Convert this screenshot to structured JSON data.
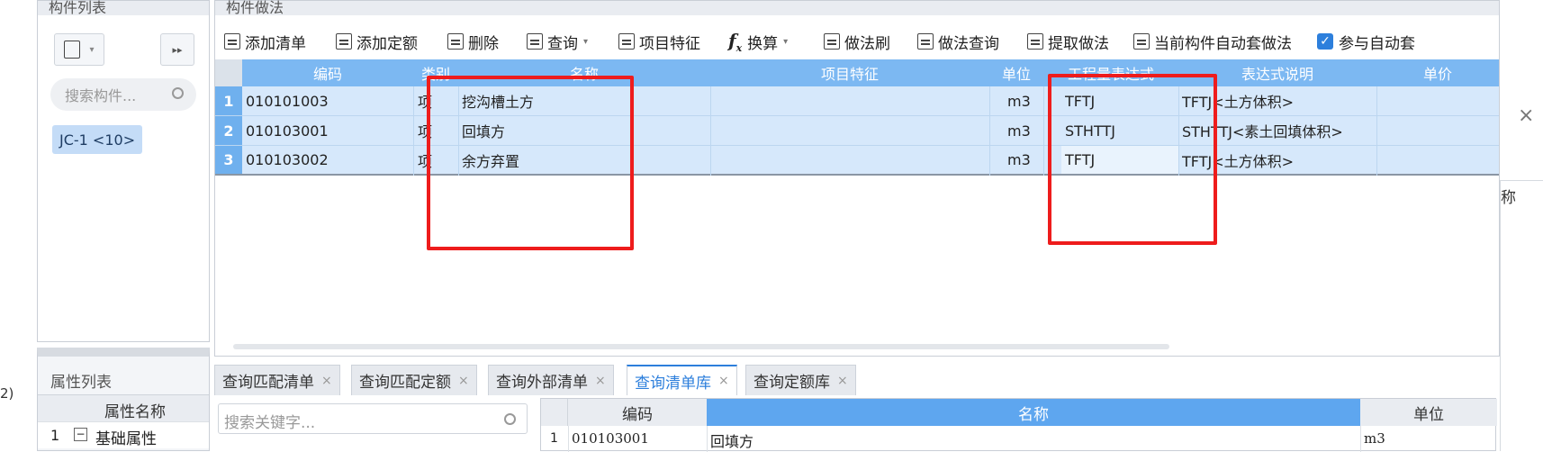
{
  "left_panel": {
    "header": "构件列表",
    "search_placeholder": "搜索构件...",
    "item": "JC-1 <10>",
    "props_header": "属性列表",
    "props_col": "属性名称",
    "props_row_num": "1",
    "props_row_toggle": "−",
    "props_row_label": "基础属性"
  },
  "method_panel": {
    "header": "构件做法",
    "toolbar": [
      {
        "label": "添加清单",
        "icon": "list-add-icon"
      },
      {
        "label": "添加定额",
        "icon": "quota-add-icon"
      },
      {
        "label": "删除",
        "icon": "trash-icon"
      },
      {
        "label": "查询",
        "icon": "query-icon",
        "dropdown": true
      },
      {
        "label": "项目特征",
        "icon": "feature-icon"
      },
      {
        "label": "换算",
        "icon": "fx-icon",
        "dropdown": true
      },
      {
        "label": "做法刷",
        "icon": "brush-icon"
      },
      {
        "label": "做法查询",
        "icon": "method-query-icon"
      },
      {
        "label": "提取做法",
        "icon": "extract-icon"
      },
      {
        "label": "当前构件自动套做法",
        "icon": "auto-apply-icon"
      }
    ],
    "checkbox_label": "参与自动套",
    "checkbox_checked": true,
    "columns": [
      "编码",
      "类别",
      "名称",
      "项目特征",
      "单位",
      "工程量表达式",
      "表达式说明",
      "单价"
    ],
    "rows": [
      {
        "num": "1",
        "code": "010101003",
        "type": "项",
        "name": "挖沟槽土方",
        "feature": "",
        "unit": "m3",
        "expr": "TFTJ",
        "desc": "TFTJ<土方体积>",
        "price": ""
      },
      {
        "num": "2",
        "code": "010103001",
        "type": "项",
        "name": "回填方",
        "feature": "",
        "unit": "m3",
        "expr": "STHTTJ",
        "desc": "STHTTJ<素土回填体积>",
        "price": ""
      },
      {
        "num": "3",
        "code": "010103002",
        "type": "项",
        "name": "余方弃置",
        "feature": "",
        "unit": "m3",
        "expr": "TFTJ",
        "desc": "TFTJ<土方体积>",
        "price": ""
      }
    ]
  },
  "bottom_tabs": [
    {
      "label": "查询匹配清单",
      "active": false
    },
    {
      "label": "查询匹配定额",
      "active": false
    },
    {
      "label": "查询外部清单",
      "active": false
    },
    {
      "label": "查询清单库",
      "active": true
    },
    {
      "label": "查询定额库",
      "active": false
    }
  ],
  "bottom": {
    "search_placeholder": "搜索关键字...",
    "columns": [
      "编码",
      "名称",
      "单位"
    ],
    "rows": [
      {
        "num": "1",
        "code": "010103001",
        "name": "回填方",
        "unit": "m3"
      }
    ]
  },
  "right_fragment": {
    "text": "称",
    "close": "×"
  },
  "left_fragment": {
    "text": "2)"
  },
  "colors": {
    "header_blue": "#7cb8f2",
    "row_blue": "#d6e8fb",
    "active_tab": "#2d7fdc",
    "highlight_red": "#ee1c1c"
  }
}
